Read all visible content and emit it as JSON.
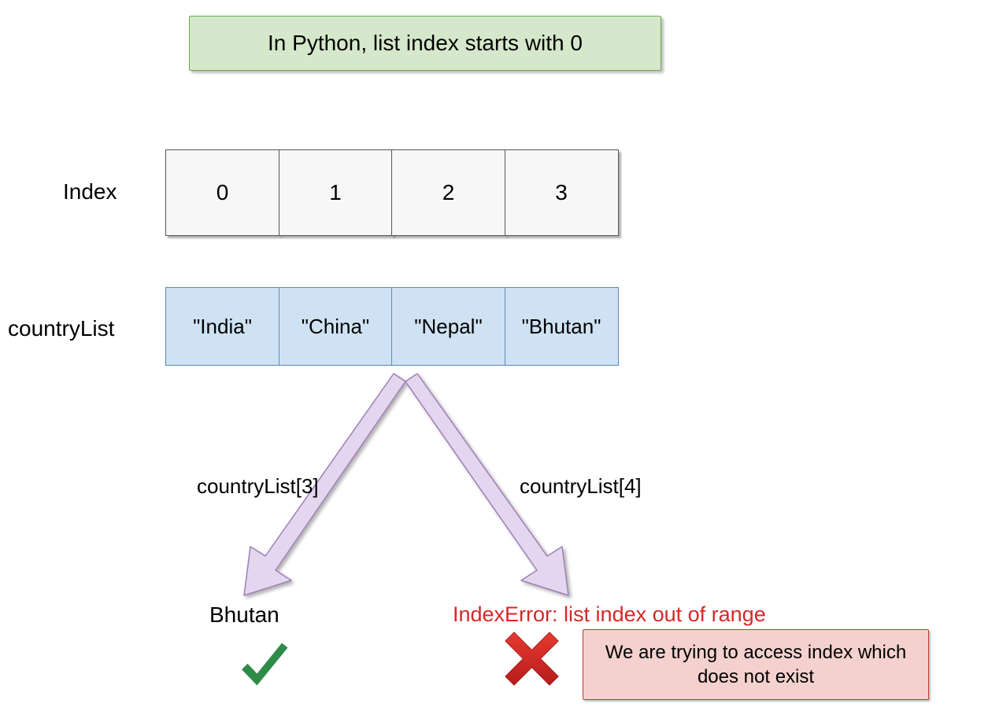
{
  "title": "In Python, list index starts with 0",
  "labels": {
    "index": "Index",
    "countryList": "countryList"
  },
  "indices": [
    "0",
    "1",
    "2",
    "3"
  ],
  "values": [
    "\"India\"",
    "\"China\"",
    "\"Nepal\"",
    "\"Bhutan\""
  ],
  "left": {
    "expr": "countryList[3]",
    "result": "Bhutan"
  },
  "right": {
    "expr": "countryList[4]",
    "error": "IndexError: list index out of range",
    "note": "We are trying to access index which does not exist"
  }
}
